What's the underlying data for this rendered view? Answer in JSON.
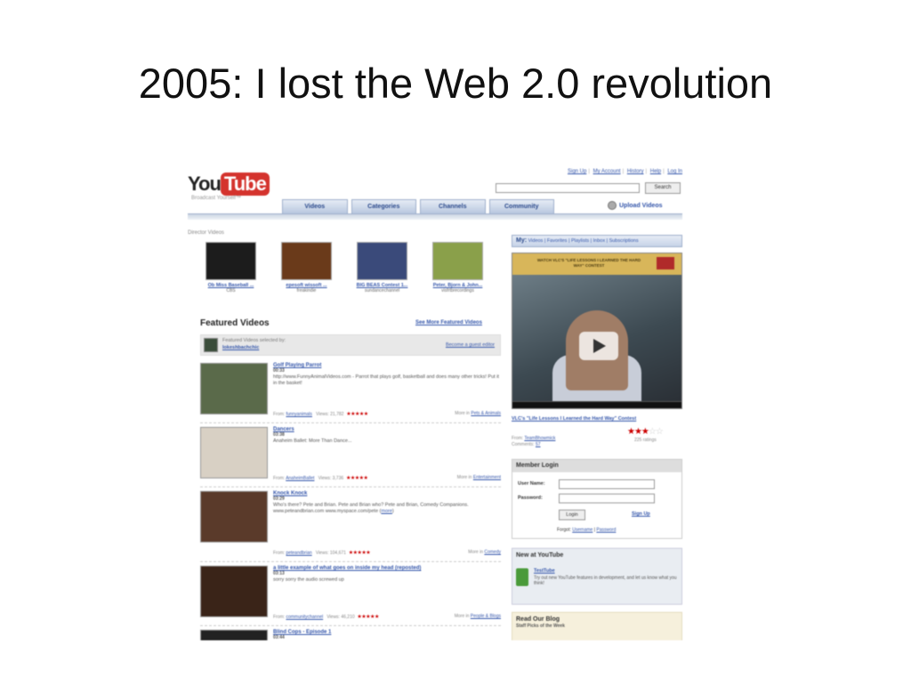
{
  "slide": {
    "title": "2005: I lost the Web 2.0 revolution"
  },
  "youtube": {
    "logo": {
      "you": "You",
      "tube": "Tube",
      "tagline": "Broadcast Yourself™"
    },
    "top_links": [
      "Sign Up",
      "My Account",
      "History",
      "Help",
      "Log In"
    ],
    "search_button": "Search",
    "nav_tabs": [
      "Videos",
      "Categories",
      "Channels",
      "Community"
    ],
    "upload_label": "Upload Videos",
    "director_label": "Director Videos",
    "director_videos": [
      {
        "title": "Ob Miss Baseball ...",
        "user": "CBS",
        "thumb_color": "#1c1c1c"
      },
      {
        "title": "epesoft wissoft ...",
        "user": "freakindie",
        "thumb_color": "#6a3a1a"
      },
      {
        "title": "BIG BEAS Contest 1...",
        "user": "sundancechannel",
        "thumb_color": "#3a4a7a"
      },
      {
        "title": "Peter, Bjorn & John...",
        "user": "visfrtbrecordings",
        "thumb_color": "#8aa04a"
      }
    ],
    "featured": {
      "heading": "Featured Videos",
      "see_more": "See More Featured Videos",
      "selected_by_label": "Featured Videos selected by:",
      "selected_by_user": "lokeshbachchic",
      "become_editor": "Become a guest editor"
    },
    "videos": [
      {
        "title": "Golf Playing Parrot",
        "duration": "00:33",
        "description": "http://www.FunnyAnimalVideos.com - Parrot that plays golf, basketball and does many other tricks! Put it in the basket!",
        "from_label": "From:",
        "user": "funnyanimals",
        "views_label": "Views:",
        "views": "21,782",
        "stars": "★★★★★",
        "more_in_label": "More in",
        "category": "Pets & Animals",
        "thumb_color": "#5a6a4a"
      },
      {
        "title": "Dancers",
        "duration": "03:38",
        "description": "Anaheim Ballet: More Than Dance...",
        "from_label": "From:",
        "user": "AnaheimBallet",
        "views_label": "Views:",
        "views": "3,736",
        "stars": "★★★★★",
        "more_in_label": "More in",
        "category": "Entertainment",
        "thumb_color": "#d8d0c4"
      },
      {
        "title": "Knock Knock",
        "duration": "03:29",
        "description": "Who's there? Pete and Brian. Pete and Brian who? Pete and Brian, Comedy Companions. www.peteandbrian.com www.myspace.com/pete",
        "more_link": "more",
        "from_label": "From:",
        "user": "peteandbrian",
        "views_label": "Views:",
        "views": "104,671",
        "stars": "★★★★★",
        "more_in_label": "More in",
        "category": "Comedy",
        "thumb_color": "#5a3a2a"
      },
      {
        "title": "a little example of what goes on inside my head (reposted)",
        "duration": "03:13",
        "description": "sorry sorry the audio screwed up",
        "from_label": "From:",
        "user": "communitychannel",
        "views_label": "Views:",
        "views": "46,210",
        "stars": "★★★★★",
        "more_in_label": "More in",
        "category": "People & Blogs",
        "thumb_color": "#3a2418"
      },
      {
        "title": "Blind Cops - Episode 1",
        "duration": "03:44",
        "description": "",
        "thumb_color": "#222222"
      }
    ],
    "my_bar": {
      "label": "My:",
      "links": [
        "Videos",
        "Favorites",
        "Playlists",
        "Inbox",
        "Subscriptions"
      ]
    },
    "player": {
      "banner_text": "WATCH VLC'S \"LIFE LESSONS I LEARNED THE HARD WAY\" CONTEST",
      "video_title": "VLC's \"Life Lessons I Learned the Hard Way\" Contest",
      "from_label": "From:",
      "user": "TeamBhowmick",
      "comments_label": "Comments:",
      "comments": "57",
      "rating_stars_on": "★★★",
      "rating_stars_off": "☆☆",
      "ratings": "225 ratings"
    },
    "login": {
      "heading": "Member Login",
      "username_label": "User Name:",
      "password_label": "Password:",
      "login_button": "Login",
      "signup": "Sign Up",
      "forgot_label": "Forgot:",
      "forgot_username": "Username",
      "forgot_password": "Password"
    },
    "new_box": {
      "heading": "New at YouTube",
      "title": "TestTube",
      "text": "Try out new YouTube features in development, and let us know what you think!"
    },
    "blog": {
      "heading": "Read Our Blog",
      "sub": "Staff Picks of the Week"
    }
  },
  "colors": {
    "youtube_red": "#d4332d",
    "link_blue": "#3355aa",
    "star_red": "#cc0000"
  }
}
